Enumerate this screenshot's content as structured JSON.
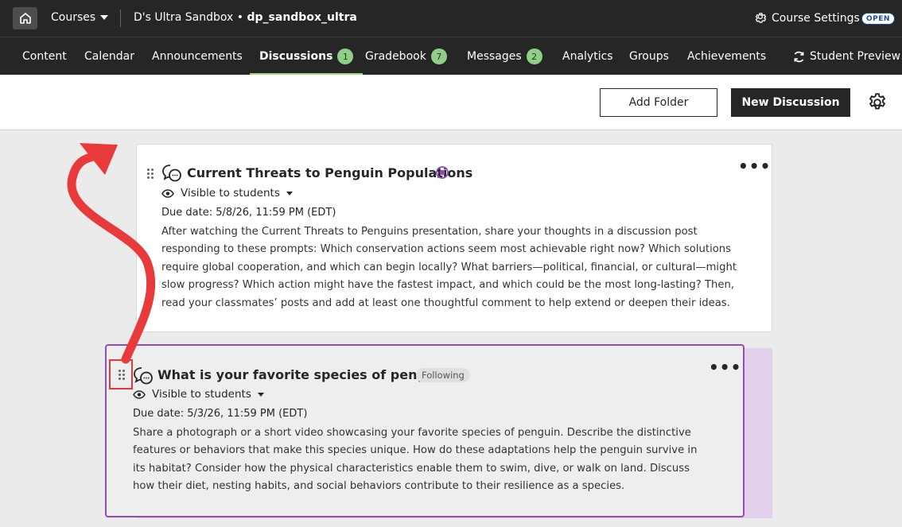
{
  "topbar": {
    "courses_label": "Courses",
    "course_name": "D's Ultra Sandbox",
    "separator": " • ",
    "course_id": "dp_sandbox_ultra",
    "course_settings_label": "Course Settings",
    "status_badge": "OPEN"
  },
  "nav": {
    "tabs": [
      {
        "label": "Content"
      },
      {
        "label": "Calendar"
      },
      {
        "label": "Announcements"
      },
      {
        "label": "Discussions",
        "count": "1",
        "active": true
      },
      {
        "label": "Gradebook",
        "count": "7"
      },
      {
        "label": "Messages",
        "count": "2"
      },
      {
        "label": "Analytics"
      },
      {
        "label": "Groups"
      },
      {
        "label": "Achievements"
      }
    ],
    "student_preview_label": "Student Preview"
  },
  "toolbar": {
    "add_folder_label": "Add Folder",
    "new_discussion_label": "New Discussion"
  },
  "discussions": [
    {
      "title": "Current Threats to Penguin Populations",
      "visibility": "Visible to students",
      "due_date": "Due date: 5/8/26, 11:59 PM (EDT)",
      "description": "After watching the Current Threats to Penguins presentation, share your thoughts in a discussion post responding to these prompts: Which conservation actions seem most achievable right now? Which solutions require global cooperation, and which can begin locally? What barriers—political, financial, or cultural—might slow progress? Which action might have the fastest impact, and which could be the most long-lasting? Then, read your classmates’ posts and add at least one thoughtful comment to help extend or deepen their ideas.",
      "more_label": "•••"
    },
    {
      "title": "What is your favorite species of penguin?",
      "badge": "Following",
      "visibility": "Visible to students",
      "due_date": "Due date: 5/3/26, 11:59 PM (EDT)",
      "description": "Share a photograph or a short video showcasing your favorite species of penguin. Describe the distinctive features or behaviors that make this species unique. How do these adaptations help the penguin survive in its habitat? Consider how the physical characteristics enable them to swim, dive, or walk on land. Discuss how their diet, nesting habits, and social behaviors contribute to their resilience as a species.",
      "more_label": "•••"
    }
  ],
  "colors": {
    "accent_green": "#8fcf87",
    "purple": "#8e4fb4",
    "annotation_red": "#e23a3a"
  },
  "icons": [
    "home-icon",
    "chevron-down-icon",
    "gear-icon",
    "refresh-icon",
    "drag-handle-icon",
    "discussion-icon",
    "eye-icon",
    "unread-icon",
    "more-options-icon"
  ]
}
